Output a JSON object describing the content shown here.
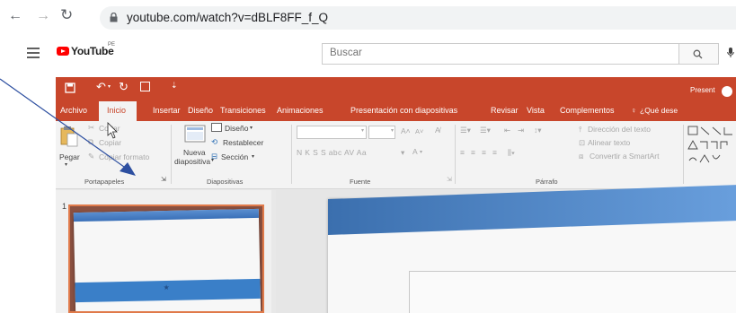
{
  "browser": {
    "back_icon": "back-arrow-icon",
    "forward_icon": "forward-arrow-icon",
    "reload_icon": "reload-icon",
    "url": "youtube.com/watch?v=dBLF8FF_f_Q"
  },
  "youtube": {
    "logo_text": "YouTube",
    "region": "PE",
    "search_placeholder": "Buscar"
  },
  "ppt": {
    "title_right": "Present",
    "tabs": [
      "Archivo",
      "Inicio",
      "Insertar",
      "Diseño",
      "Transiciones",
      "Animaciones",
      "Presentación con diapositivas",
      "Revisar",
      "Vista",
      "Complementos"
    ],
    "tell_me": "¿Qué dese",
    "clipboard": {
      "paste": "Pegar",
      "cut": "Cortar",
      "copy": "Copiar",
      "format_painter": "Copiar formato",
      "group": "Portapapeles"
    },
    "slides": {
      "new_slide_1": "Nueva",
      "new_slide_2": "diapositiva",
      "layout": "Diseño",
      "reset": "Restablecer",
      "section": "Sección",
      "group": "Diapositivas"
    },
    "font": {
      "buttons": "N  K  S  S  abc  AV  Aa",
      "group": "Fuente"
    },
    "paragraph": {
      "text_direction": "Dirección del texto",
      "align_text": "Alinear texto",
      "smartart": "Convertir a SmartArt",
      "group": "Párrafo"
    },
    "slide_number": "1"
  },
  "colors": {
    "ppt_accent": "#c8462b",
    "annotation_arrow": "#2d4fa0",
    "youtube_red": "#ff0000"
  }
}
